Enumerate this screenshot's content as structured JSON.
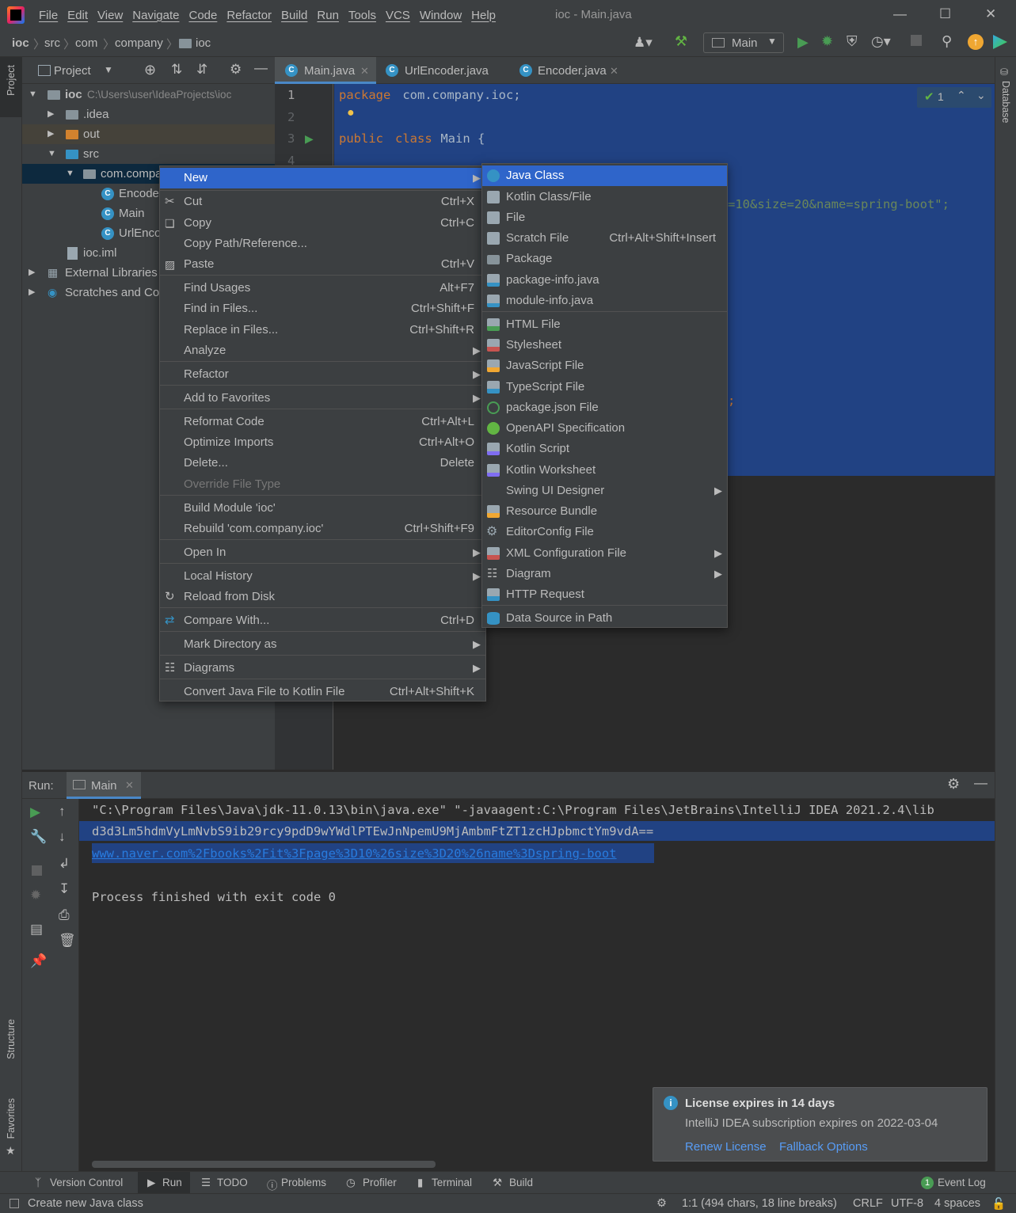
{
  "menubar": [
    "File",
    "Edit",
    "View",
    "Navigate",
    "Code",
    "Refactor",
    "Build",
    "Run",
    "Tools",
    "VCS",
    "Window",
    "Help"
  ],
  "window_title": "ioc - Main.java",
  "breadcrumbs": [
    "ioc",
    "src",
    "com",
    "company",
    "ioc"
  ],
  "run_config": "Main",
  "project_panel": {
    "title": "Project",
    "tree": [
      {
        "label": "ioc",
        "path": "C:\\Users\\user\\IdeaProjects\\ioc"
      },
      {
        "label": ".idea"
      },
      {
        "label": "out"
      },
      {
        "label": "src"
      },
      {
        "label": "com.compa"
      },
      {
        "label": "Encode"
      },
      {
        "label": "Main"
      },
      {
        "label": "UrlEnco"
      },
      {
        "label": "ioc.iml"
      },
      {
        "label": "External Libraries"
      },
      {
        "label": "Scratches and Co"
      }
    ]
  },
  "editor": {
    "tabs": [
      "Main.java",
      "UrlEncoder.java",
      "Encoder.java"
    ],
    "line_numbers": [
      "1",
      "2",
      "3",
      "4"
    ],
    "code": {
      "kw_package": "package",
      "package_name": " com.company.ioc;",
      "kw_public": "public",
      "kw_class": "class",
      "class_decl": " Main {",
      "string_fragment": "=10&size=20&name=spring-boot\";",
      "semicolon": ";"
    },
    "inspection_count": "1"
  },
  "context_menu": {
    "items": [
      {
        "label": "New",
        "shortcut": "",
        "submenu": true
      },
      {
        "label": "Cut",
        "shortcut": "Ctrl+X"
      },
      {
        "label": "Copy",
        "shortcut": "Ctrl+C"
      },
      {
        "label": "Copy Path/Reference...",
        "shortcut": ""
      },
      {
        "label": "Paste",
        "shortcut": "Ctrl+V"
      },
      {
        "label": "Find Usages",
        "shortcut": "Alt+F7"
      },
      {
        "label": "Find in Files...",
        "shortcut": "Ctrl+Shift+F"
      },
      {
        "label": "Replace in Files...",
        "shortcut": "Ctrl+Shift+R"
      },
      {
        "label": "Analyze",
        "shortcut": "",
        "submenu": true
      },
      {
        "label": "Refactor",
        "shortcut": "",
        "submenu": true
      },
      {
        "label": "Add to Favorites",
        "shortcut": "",
        "submenu": true
      },
      {
        "label": "Reformat Code",
        "shortcut": "Ctrl+Alt+L"
      },
      {
        "label": "Optimize Imports",
        "shortcut": "Ctrl+Alt+O"
      },
      {
        "label": "Delete...",
        "shortcut": "Delete"
      },
      {
        "label": "Override File Type",
        "shortcut": "",
        "disabled": true
      },
      {
        "label": "Build Module 'ioc'",
        "shortcut": ""
      },
      {
        "label": "Rebuild 'com.company.ioc'",
        "shortcut": "Ctrl+Shift+F9"
      },
      {
        "label": "Open In",
        "shortcut": "",
        "submenu": true
      },
      {
        "label": "Local History",
        "shortcut": "",
        "submenu": true
      },
      {
        "label": "Reload from Disk",
        "shortcut": ""
      },
      {
        "label": "Compare With...",
        "shortcut": "Ctrl+D"
      },
      {
        "label": "Mark Directory as",
        "shortcut": "",
        "submenu": true
      },
      {
        "label": "Diagrams",
        "shortcut": "",
        "submenu": true
      },
      {
        "label": "Convert Java File to Kotlin File",
        "shortcut": "Ctrl+Alt+Shift+K"
      }
    ]
  },
  "new_submenu": {
    "items": [
      {
        "label": "Java Class",
        "icon": "java-class-icon",
        "color": "#3592c4"
      },
      {
        "label": "Kotlin Class/File",
        "icon": "kotlin-file-icon",
        "color": "#7f6df2"
      },
      {
        "label": "File",
        "icon": "file-icon",
        "color": "#9aa7b0"
      },
      {
        "label": "Scratch File",
        "shortcut": "Ctrl+Alt+Shift+Insert",
        "icon": "scratch-file-icon",
        "color": "#9aa7b0"
      },
      {
        "label": "Package",
        "icon": "package-icon",
        "color": "#87939a"
      },
      {
        "label": "package-info.java",
        "icon": "java-file-icon",
        "color": "#3592c4"
      },
      {
        "label": "module-info.java",
        "icon": "java-file-icon",
        "color": "#3592c4"
      },
      {
        "label": "HTML File",
        "icon": "html-file-icon",
        "color": "#499c54"
      },
      {
        "label": "Stylesheet",
        "icon": "css-file-icon",
        "color": "#c75450"
      },
      {
        "label": "JavaScript File",
        "icon": "js-file-icon",
        "color": "#f0a732"
      },
      {
        "label": "TypeScript File",
        "icon": "ts-file-icon",
        "color": "#3592c4"
      },
      {
        "label": "package.json File",
        "icon": "npm-icon",
        "color": "#499c54"
      },
      {
        "label": "OpenAPI Specification",
        "icon": "openapi-icon",
        "color": "#62b543"
      },
      {
        "label": "Kotlin Script",
        "icon": "kotlin-script-icon",
        "color": "#7f6df2"
      },
      {
        "label": "Kotlin Worksheet",
        "icon": "kotlin-worksheet-icon",
        "color": "#7f6df2"
      },
      {
        "label": "Swing UI Designer",
        "submenu": true,
        "icon": "",
        "color": ""
      },
      {
        "label": "Resource Bundle",
        "icon": "resource-bundle-icon",
        "color": "#f0a732"
      },
      {
        "label": "EditorConfig File",
        "icon": "gear-icon",
        "color": "#9aa7b0"
      },
      {
        "label": "XML Configuration File",
        "submenu": true,
        "icon": "xml-file-icon",
        "color": "#c75450"
      },
      {
        "label": "Diagram",
        "submenu": true,
        "icon": "diagram-icon",
        "color": "#3592c4"
      },
      {
        "label": "HTTP Request",
        "icon": "http-request-icon",
        "color": "#3592c4"
      },
      {
        "label": "Data Source in Path",
        "icon": "database-icon",
        "color": "#3592c4"
      }
    ]
  },
  "run_panel": {
    "label": "Run:",
    "tab": "Main",
    "console": [
      "\"C:\\Program Files\\Java\\jdk-11.0.13\\bin\\java.exe\" \"-javaagent:C:\\Program Files\\JetBrains\\IntelliJ IDEA 2021.2.4\\lib",
      "d3d3Lm5hdmVyLmNvbS9ib29rcy9pdD9wYWdlPTEwJnNpemU9MjAmbmFtZT1zcHJpbmctYm9vdA==",
      "www.naver.com%2Fbooks%2Fit%3Fpage%3D10%26size%3D20%26name%3Dspring-boot",
      "",
      "Process finished with exit code 0"
    ]
  },
  "notification": {
    "title": "License expires in 14 days",
    "body": "IntelliJ IDEA subscription expires on 2022-03-04",
    "actions": [
      "Renew License",
      "Fallback Options"
    ]
  },
  "left_strip": {
    "project": "Project",
    "structure": "Structure",
    "favorites": "Favorites"
  },
  "right_strip": {
    "database": "Database"
  },
  "bottom_tools": [
    "Version Control",
    "Run",
    "TODO",
    "Problems",
    "Profiler",
    "Terminal",
    "Build"
  ],
  "event_log": {
    "count": "1",
    "label": "Event Log"
  },
  "statusbar": {
    "message": "Create new Java class",
    "position": "1:1 (494 chars, 18 line breaks)",
    "line_sep": "CRLF",
    "encoding": "UTF-8",
    "indent": "4 spaces"
  },
  "colors": {
    "selection": "#2f65ca",
    "editor_selection": "#214283",
    "keyword": "#cc7832",
    "string": "#6a8759",
    "link": "#287bde"
  }
}
